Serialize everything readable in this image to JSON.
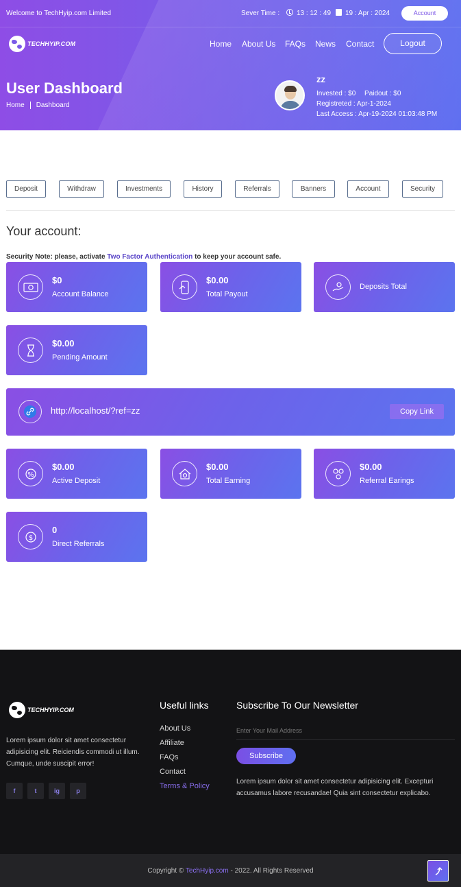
{
  "topbar": {
    "welcome": "Welcome to TechHyip.com Limited",
    "server_label": "Sever Time :",
    "time": "13 : 12 : 49",
    "date": "19 : Apr : 2024",
    "account_button": "Account"
  },
  "brand": {
    "logo_text": "TECHHYIP.COM"
  },
  "nav": {
    "home": "Home",
    "about": "About Us",
    "faqs": "FAQs",
    "news": "News",
    "contact": "Contact",
    "logout": "Logout"
  },
  "hero": {
    "title": "User Dashboard",
    "breadcrumb": [
      "Home",
      "Dashboard"
    ]
  },
  "user": {
    "name": "zz",
    "invested": "Invested  :  $0",
    "paidout": "Paidout  :  $0",
    "registered": "Registreted  :  Apr-1-2024",
    "last_access": "Last Access  :  Apr-19-2024 01:03:48 PM"
  },
  "tabs": [
    "Deposit",
    "Withdraw",
    "Investments",
    "History",
    "Referrals",
    "Banners",
    "Account",
    "Security"
  ],
  "account": {
    "heading": "Your account:",
    "security_prefix": "Security Note: please, activate ",
    "security_link": "Two Factor Authentication",
    "security_suffix": " to keep your account safe."
  },
  "cards_top": [
    {
      "value": "$0",
      "label": "Account Balance",
      "icon": "money-icon"
    },
    {
      "value": "$0.00",
      "label": "Total Payout",
      "icon": "payout-icon"
    },
    {
      "value": "",
      "label": "Deposits Total",
      "icon": "deposit-icon"
    },
    {
      "value": "$0.00",
      "label": "Pending Amount",
      "icon": "hourglass-icon"
    }
  ],
  "referral": {
    "url": "http://localhost/?ref=zz",
    "copy_button": "Copy Link",
    "icon": "link-icon"
  },
  "cards_bottom": [
    {
      "value": "$0.00",
      "label": "Active Deposit",
      "icon": "active-deposit-icon"
    },
    {
      "value": "$0.00",
      "label": "Total Earning",
      "icon": "earning-icon"
    },
    {
      "value": "$0.00",
      "label": "Referral Earings",
      "icon": "referral-icon"
    },
    {
      "value": "0",
      "label": "Direct Referrals",
      "icon": "dollar-cycle-icon"
    }
  ],
  "footer": {
    "about": "Lorem ipsum dolor sit amet consectetur adipisicing elit. Reiciendis commodi ut illum. Cumque, unde suscipit error!",
    "social": [
      "f",
      "t",
      "ig",
      "p"
    ],
    "links_title": "Useful links",
    "links": [
      "About Us",
      "Affiliate",
      "FAQs",
      "Contact",
      "Terms & Policy"
    ],
    "newsletter_title": "Subscribe To Our Newsletter",
    "mail_placeholder": "Enter Your Mail Address",
    "subscribe_button": "Subscribe",
    "newsletter_text": "Lorem ipsum dolor sit amet consectetur adipisicing elit. Excepturi accusamus labore recusandae! Quia sint consectetur explicabo."
  },
  "copyright": {
    "prefix": "Copyright © ",
    "brand": "TechHyip.com",
    "suffix": " - 2022. All Rights Reserved"
  },
  "colors": {
    "accent_start": "#8a4fe4",
    "accent_end": "#5b74ef",
    "footer_bg": "#131315"
  }
}
